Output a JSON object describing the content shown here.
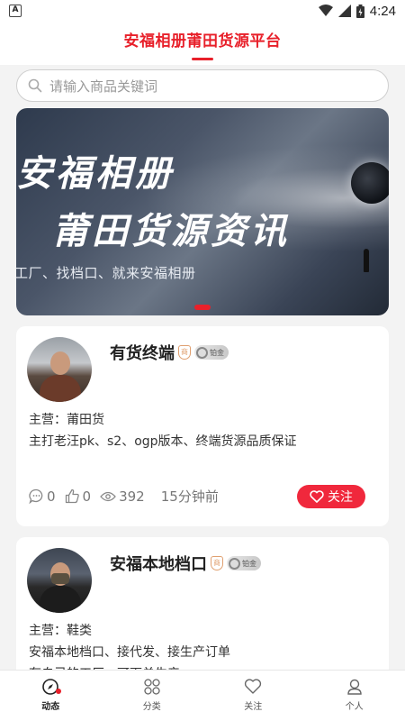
{
  "status_bar": {
    "time": "4:24",
    "app_badge": "A"
  },
  "header": {
    "title": "安福相册莆田货源平台"
  },
  "search": {
    "placeholder": "请输入商品关键词"
  },
  "banner": {
    "title_line1": "安福相册",
    "title_line2": "莆田货源资讯",
    "subtitle": "工厂、找档口、就来安福相册"
  },
  "posts": [
    {
      "shop_name": "有货终端",
      "shop_badge": "商",
      "level": "铂金",
      "main_category": "主营：莆田货",
      "description": "主打老汪pk、s2、ogp版本、终端货源品质保证",
      "comments": "0",
      "likes": "0",
      "views": "392",
      "time": "15分钟前",
      "follow_label": "关注"
    },
    {
      "shop_name": "安福本地档口",
      "shop_badge": "商",
      "level": "铂金",
      "main_category": "主营：鞋类",
      "description": "安福本地档口、接代发、接生产订单",
      "description2": "有自己的工厂、可下单生产"
    }
  ],
  "tabbar": [
    {
      "label": "动态",
      "icon": "compass-icon",
      "active": true
    },
    {
      "label": "分类",
      "icon": "grid-icon",
      "active": false
    },
    {
      "label": "关注",
      "icon": "heart-icon",
      "active": false
    },
    {
      "label": "个人",
      "icon": "person-icon",
      "active": false
    }
  ],
  "colors": {
    "accent": "#e8202a",
    "follow_button": "#f0283c"
  }
}
